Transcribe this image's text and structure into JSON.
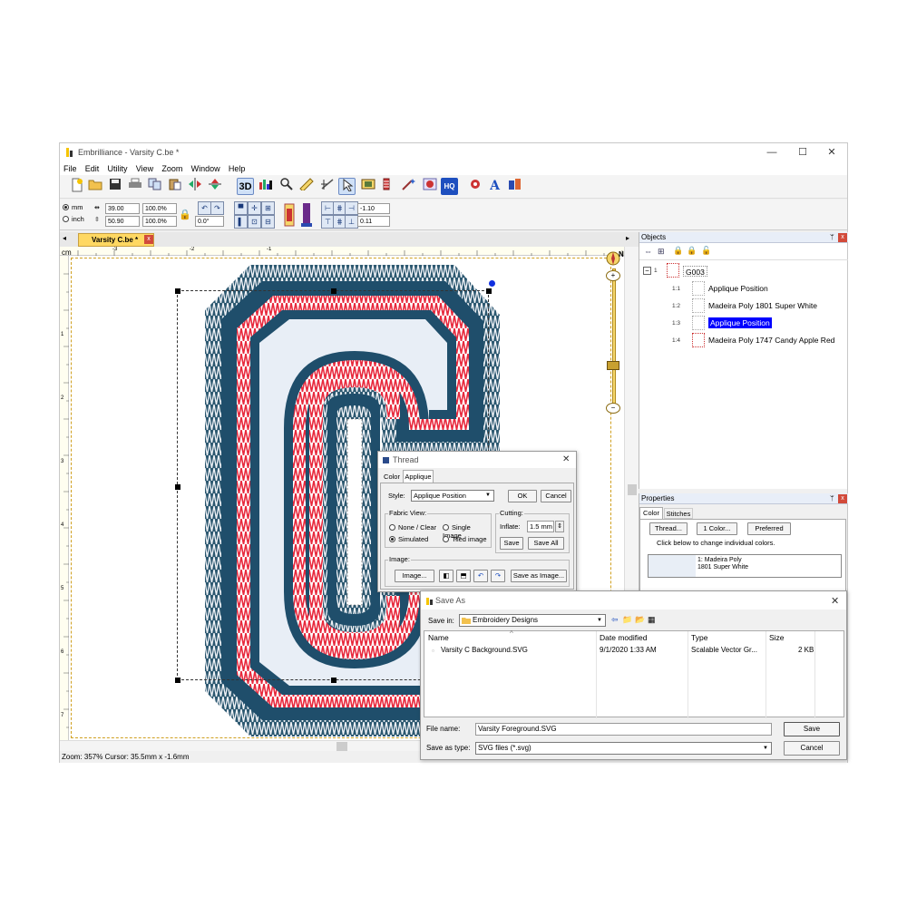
{
  "window": {
    "app_title": "Embrilliance - Varsity C.be *",
    "min": "—",
    "max": "☐",
    "close": "✕"
  },
  "menu": [
    "File",
    "Edit",
    "Utility",
    "View",
    "Zoom",
    "Window",
    "Help"
  ],
  "toolbar": {
    "btn_3d": "3D",
    "btn_hq": "HQ"
  },
  "props_bar": {
    "unit_mm": "mm",
    "unit_inch": "inch",
    "width": "39.00",
    "height": "50.90",
    "width_pct": "100.0%",
    "height_pct": "100.0%",
    "rotation": "0.0°",
    "skew_x": "-1.10",
    "skew_y": "0.11"
  },
  "doc_tab": {
    "label": "Varsity C.be *",
    "close": "x",
    "nav_left": "◂",
    "nav_right": "▸"
  },
  "ruler": {
    "unit": "cm",
    "top_ticks": [
      "-3",
      "-2",
      "-1"
    ],
    "left_ticks": [
      "1",
      "2",
      "3",
      "4",
      "5",
      "6",
      "7"
    ]
  },
  "compass": "N",
  "status": {
    "text": "Zoom: 357%  Cursor: 35.5mm x -1.6mm"
  },
  "objects_panel": {
    "title": "Objects",
    "pin": "ᛘ",
    "close": "x",
    "group_label": "G003",
    "group_num": "1",
    "items": [
      {
        "num": "1:1",
        "label": "Applique Position",
        "selected": false
      },
      {
        "num": "1:2",
        "label": "Madeira Poly 1801 Super White",
        "selected": false
      },
      {
        "num": "1:3",
        "label": "Applique Position",
        "selected": true
      },
      {
        "num": "1:4",
        "label": "Madeira Poly 1747 Candy Apple Red",
        "selected": false
      }
    ]
  },
  "properties_panel": {
    "title": "Properties",
    "pin": "ᛘ",
    "close": "x",
    "tabs": [
      "Color",
      "Stitches"
    ],
    "buttons": [
      "Thread...",
      "1 Color...",
      "Preferred"
    ],
    "hint": "Click below to change individual colors.",
    "color_row": "1: Madeira Poly\n1801 Super White"
  },
  "thread_dialog": {
    "title": "Thread",
    "close": "✕",
    "tabs": [
      "Color",
      "Applique"
    ],
    "style_label": "Style:",
    "style_value": "Applique Position",
    "ok": "OK",
    "cancel": "Cancel",
    "fabric_view_label": "Fabric View:",
    "fabric_options": [
      "None / Clear",
      "Single Image",
      "Simulated",
      "Tiled image"
    ],
    "fabric_selected": "Simulated",
    "cutting_label": "Cutting:",
    "inflate_label": "Inflate:",
    "inflate_value": "1.5 mm",
    "save": "Save",
    "save_all": "Save All",
    "image_group_label": "Image:",
    "image_button": "Image...",
    "save_as_image": "Save as Image..."
  },
  "save_dialog": {
    "title": "Save As",
    "close": "✕",
    "save_in_label": "Save in:",
    "save_in_value": "Embroidery Designs",
    "columns": [
      "Name",
      "Date modified",
      "Type",
      "Size"
    ],
    "files": [
      {
        "name": "Varsity C Background.SVG",
        "date": "9/1/2020 1:33 AM",
        "type": "Scalable Vector Gr...",
        "size": "2 KB"
      }
    ],
    "file_name_label": "File name:",
    "file_name_value": "Varsity Foreground.SVG",
    "save_type_label": "Save as type:",
    "save_type_value": "SVG files (*.svg)",
    "save": "Save",
    "cancel": "Cancel"
  },
  "colors": {
    "navy": "#1f4e6b",
    "red": "#e8283c",
    "white_fill": "#e8eef6",
    "selection": "#0000ff",
    "tab_yellow": "#ffd862"
  }
}
